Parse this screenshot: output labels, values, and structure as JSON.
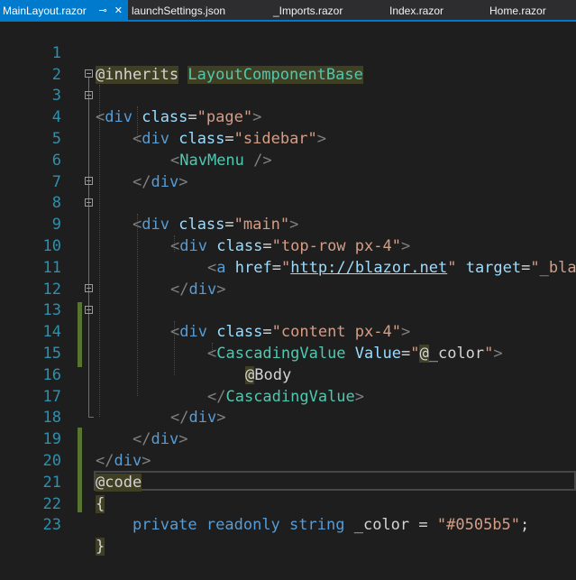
{
  "tabs": [
    {
      "label": "MainLayout.razor",
      "active": true,
      "pin_icon": "pin-icon",
      "close_icon": "close-icon"
    },
    {
      "label": "launchSettings.json",
      "active": false
    },
    {
      "label": "_Imports.razor",
      "active": false
    },
    {
      "label": "Index.razor",
      "active": false
    },
    {
      "label": "Home.razor",
      "active": false
    }
  ],
  "colors": {
    "accent": "#007acc",
    "background": "#1e1e1e",
    "line_number": "#2b91af",
    "tag": "#569cd6",
    "attribute": "#9cdcfe",
    "string": "#d69d85",
    "component": "#4ec9b0",
    "change_bar": "#577430"
  },
  "editor": {
    "line_numbers": [
      "1",
      "2",
      "3",
      "4",
      "5",
      "6",
      "7",
      "8",
      "9",
      "10",
      "11",
      "12",
      "13",
      "14",
      "15",
      "16",
      "17",
      "18",
      "19",
      "20",
      "21",
      "22",
      "23"
    ],
    "l1": {
      "directive": "@inherits",
      "type": "LayoutComponentBase"
    },
    "l3": {
      "open": "<",
      "tag": "div",
      "attr": "class",
      "eq": "=",
      "val": "\"page\"",
      "close": ">"
    },
    "l4": {
      "open": "<",
      "tag": "div",
      "attr": "class",
      "eq": "=",
      "val": "\"sidebar\"",
      "close": ">"
    },
    "l5": {
      "open": "<",
      "comp": "NavMenu",
      "close": " />"
    },
    "l6": {
      "open": "</",
      "tag": "div",
      "close": ">"
    },
    "l8": {
      "open": "<",
      "tag": "div",
      "attr": "class",
      "eq": "=",
      "val": "\"main\"",
      "close": ">"
    },
    "l9": {
      "open": "<",
      "tag": "div",
      "attr": "class",
      "eq": "=",
      "val": "\"top-row px-4\"",
      "close": ">"
    },
    "l10": {
      "open": "<",
      "tag": "a",
      "attr": "href",
      "eq": "=",
      "q1": "\"",
      "url": "http://blazor.net",
      "q2": "\"",
      "attr2": "target",
      "eq2": "=",
      "val2": "\"_bla"
    },
    "l11": {
      "open": "</",
      "tag": "div",
      "close": ">"
    },
    "l13": {
      "open": "<",
      "tag": "div",
      "attr": "class",
      "eq": "=",
      "val": "\"content px-4\"",
      "close": ">"
    },
    "l14": {
      "open": "<",
      "comp": "CascadingValue",
      "attr": "Value",
      "eq": "=",
      "q1": "\"",
      "at": "@",
      "expr": "_color",
      "q2": "\"",
      "close": ">"
    },
    "l15": {
      "at": "@",
      "expr": "Body"
    },
    "l16": {
      "open": "</",
      "comp": "CascadingValue",
      "close": ">"
    },
    "l17": {
      "open": "</",
      "tag": "div",
      "close": ">"
    },
    "l18": {
      "open": "</",
      "tag": "div",
      "close": ">"
    },
    "l19": {
      "open": "</",
      "tag": "div",
      "close": ">"
    },
    "l20": {
      "directive": "@code"
    },
    "l21": {
      "brace": "{"
    },
    "l22": {
      "kw1": "private",
      "kw2": "readonly",
      "kw3": "string",
      "ident": "_color",
      "op": "=",
      "str": "\"#0505b5\"",
      "semi": ";"
    },
    "l23": {
      "brace": "}"
    }
  }
}
